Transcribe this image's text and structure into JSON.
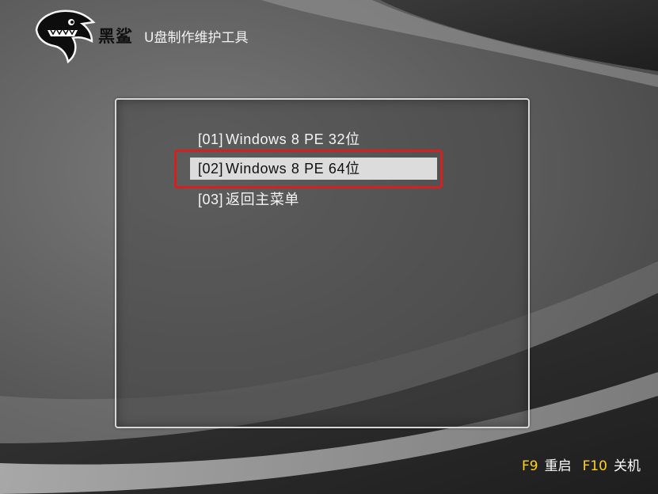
{
  "brand": {
    "name": "黑鲨",
    "app_title": "U盘制作维护工具",
    "logo_icon": "shark-logo-icon"
  },
  "menu": {
    "items": [
      {
        "tag": "[01]",
        "label": "Windows 8 PE 32位",
        "selected": false
      },
      {
        "tag": "[02]",
        "label": "Windows 8 PE 64位",
        "selected": true
      },
      {
        "tag": "[03]",
        "label": "返回主菜单",
        "selected": false
      }
    ]
  },
  "hotkeys": {
    "restart": {
      "key": "F9",
      "label": "重启"
    },
    "shutdown": {
      "key": "F10",
      "label": "关机"
    }
  },
  "colors": {
    "highlight_border": "#d91e1e",
    "hotkey_color": "#ffd21a",
    "selection_bg": "#dcdcdc"
  }
}
